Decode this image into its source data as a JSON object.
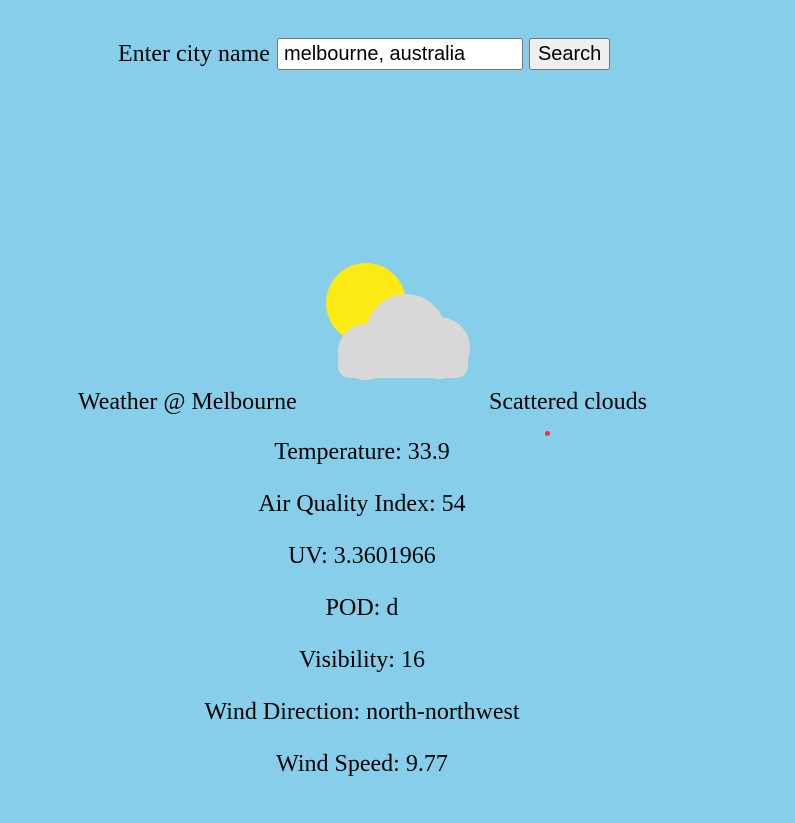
{
  "search": {
    "label": "Enter city name",
    "value": "melbourne, australia",
    "button_label": "Search"
  },
  "weather": {
    "icon": "sun-behind-cloud-icon",
    "city_label": "Weather @ Melbourne",
    "description": "Scattered clouds",
    "details": [
      "Temperature: 33.9",
      "Air Quality Index: 54",
      "UV: 3.3601966",
      "POD: d",
      "Visibility: 16",
      "Wind Direction: north-northwest",
      "Wind Speed: 9.77"
    ]
  },
  "colors": {
    "background": "#87ceeb",
    "sun": "#fceb12",
    "cloud": "#d8d8d8",
    "dot": "#e53935"
  }
}
